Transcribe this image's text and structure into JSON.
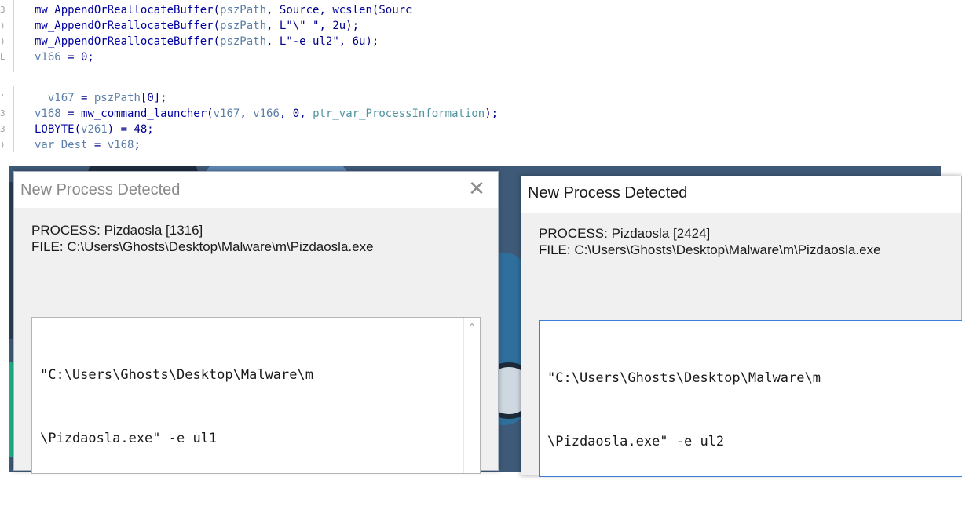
{
  "code_top": {
    "lines": [
      {
        "gutter": "3",
        "parts": [
          {
            "t": "fn",
            "v": "mw_AppendOrReallocateBuffer"
          },
          {
            "t": "p",
            "v": "("
          },
          {
            "t": "var",
            "v": "pszPath"
          },
          {
            "t": "p",
            "v": ", Source, "
          },
          {
            "t": "fn",
            "v": "wcslen"
          },
          {
            "t": "p",
            "v": "(Sourc"
          }
        ]
      },
      {
        "gutter": ")",
        "parts": [
          {
            "t": "fn",
            "v": "mw_AppendOrReallocateBuffer"
          },
          {
            "t": "p",
            "v": "("
          },
          {
            "t": "var",
            "v": "pszPath"
          },
          {
            "t": "p",
            "v": ", L\"\\\" \", 2u);"
          }
        ]
      },
      {
        "gutter": ")",
        "parts": [
          {
            "t": "fn",
            "v": "mw_AppendOrReallocateBuffer"
          },
          {
            "t": "p",
            "v": "("
          },
          {
            "t": "var",
            "v": "pszPath"
          },
          {
            "t": "p",
            "v": ", L\"-e ul2\", 6u);"
          }
        ]
      },
      {
        "gutter": "L",
        "parts": [
          {
            "t": "var",
            "v": "v166"
          },
          {
            "t": "p",
            "v": " = 0;"
          }
        ]
      }
    ]
  },
  "code_bottom": {
    "lines": [
      {
        "gutter": "'",
        "parts": [
          {
            "t": "p",
            "v": "  "
          },
          {
            "t": "var",
            "v": "v167"
          },
          {
            "t": "p",
            "v": " = "
          },
          {
            "t": "var",
            "v": "pszPath"
          },
          {
            "t": "p",
            "v": "[0];"
          }
        ]
      },
      {
        "gutter": "3",
        "parts": [
          {
            "t": "var",
            "v": "v168"
          },
          {
            "t": "p",
            "v": " = "
          },
          {
            "t": "fn",
            "v": "mw_command_launcher"
          },
          {
            "t": "p",
            "v": "("
          },
          {
            "t": "var",
            "v": "v167"
          },
          {
            "t": "p",
            "v": ", "
          },
          {
            "t": "var",
            "v": "v166"
          },
          {
            "t": "p",
            "v": ", 0, "
          },
          {
            "t": "ptr",
            "v": "ptr_var_ProcessInformation"
          },
          {
            "t": "p",
            "v": ");"
          }
        ]
      },
      {
        "gutter": "3",
        "parts": [
          {
            "t": "fn",
            "v": "LOBYTE"
          },
          {
            "t": "p",
            "v": "("
          },
          {
            "t": "var",
            "v": "v261"
          },
          {
            "t": "p",
            "v": ") = 48;"
          }
        ]
      },
      {
        "gutter": ")",
        "parts": [
          {
            "t": "var",
            "v": "var_Dest"
          },
          {
            "t": "p",
            "v": " = "
          },
          {
            "t": "var",
            "v": "v168"
          },
          {
            "t": "p",
            "v": ";"
          }
        ]
      }
    ]
  },
  "dialog_left": {
    "title": "New Process Detected",
    "close_icon": "close-icon",
    "process_line": "PROCESS: Pizdaosla [1316]",
    "file_line": "FILE: C:\\Users\\Ghosts\\Desktop\\Malware\\m\\Pizdaosla.exe",
    "command_line_1": "\"C:\\Users\\Ghosts\\Desktop\\Malware\\m",
    "command_line_2": "\\Pizdaosla.exe\" -e ul1",
    "scroll_icon": "scroll-up-icon"
  },
  "dialog_right": {
    "title": "New Process Detected",
    "process_line": "PROCESS: Pizdaosla [2424]",
    "file_line": "FILE: C:\\Users\\Ghosts\\Desktop\\Malware\\m\\Pizdaosla.exe",
    "command_line_1": "\"C:\\Users\\Ghosts\\Desktop\\Malware\\m",
    "command_line_2": "\\Pizdaosla.exe\" -e ul2"
  },
  "colors": {
    "code_text": "#00008b",
    "code_var": "#5b7fa8",
    "code_ptr": "#4f93a0",
    "focus_border": "#3c7fd8"
  }
}
